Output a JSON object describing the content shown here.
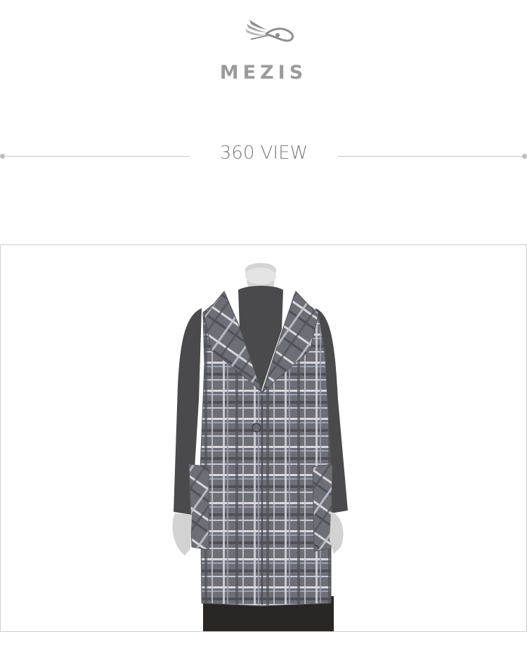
{
  "header": {
    "brand_name": "MEZIS",
    "logo_icon": "winged-ribbon-logo",
    "brand_color": "#9b9b9b"
  },
  "section": {
    "title": "360 VIEW"
  },
  "viewer": {
    "image_subject": "plaid-vest-on-mannequin",
    "colors": {
      "plaid_base": "#6e7078",
      "undershirt": "#4a4a4c",
      "pants": "#2a2624",
      "mannequin": "#d4d4d4"
    }
  }
}
